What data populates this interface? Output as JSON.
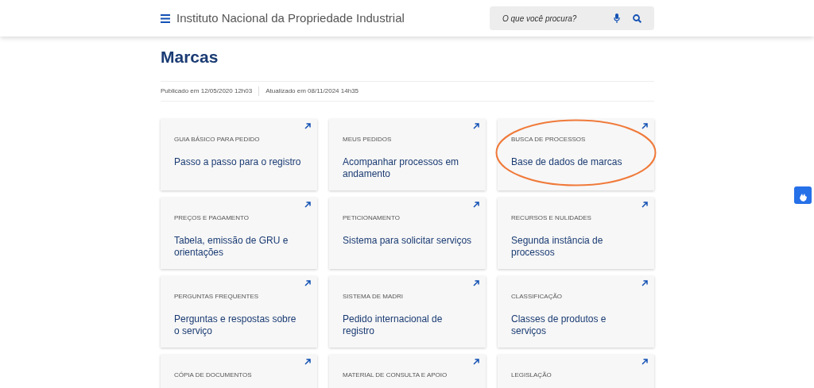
{
  "header": {
    "title": "Instituto Nacional da Propriedade Industrial",
    "search": {
      "placeholder": "O que você procura?"
    }
  },
  "page": {
    "title": "Marcas",
    "published": "Publicado em 12/05/2020 12h03",
    "updated": "Atualizado em 08/11/2024 14h35"
  },
  "cards": [
    {
      "category": "GUIA BÁSICO PARA PEDIDO",
      "title": "Passo a passo para o registro",
      "highlighted": false
    },
    {
      "category": "MEUS PEDIDOS",
      "title": "Acompanhar processos em andamento",
      "highlighted": false
    },
    {
      "category": "BUSCA DE PROCESSOS",
      "title": "Base de dados de marcas",
      "highlighted": true
    },
    {
      "category": "PREÇOS E PAGAMENTO",
      "title": "Tabela, emissão de GRU e orientações",
      "highlighted": false
    },
    {
      "category": "PETICIONAMENTO",
      "title": "Sistema para solicitar serviços",
      "highlighted": false
    },
    {
      "category": "RECURSOS E NULIDADES",
      "title": "Segunda instância de processos",
      "highlighted": false
    },
    {
      "category": "PERGUNTAS FREQUENTES",
      "title": "Perguntas e respostas sobre o serviço",
      "highlighted": false
    },
    {
      "category": "SISTEMA DE MADRI",
      "title": "Pedido internacional de registro",
      "highlighted": false
    },
    {
      "category": "CLASSIFICAÇÃO",
      "title": "Classes de produtos e serviços",
      "highlighted": false
    },
    {
      "category": "CÓPIA DE DOCUMENTOS",
      "highlighted": false
    },
    {
      "category": "MATERIAL DE CONSULTA E APOIO",
      "highlighted": false
    },
    {
      "category": "LEGISLAÇÃO",
      "highlighted": false
    }
  ]
}
